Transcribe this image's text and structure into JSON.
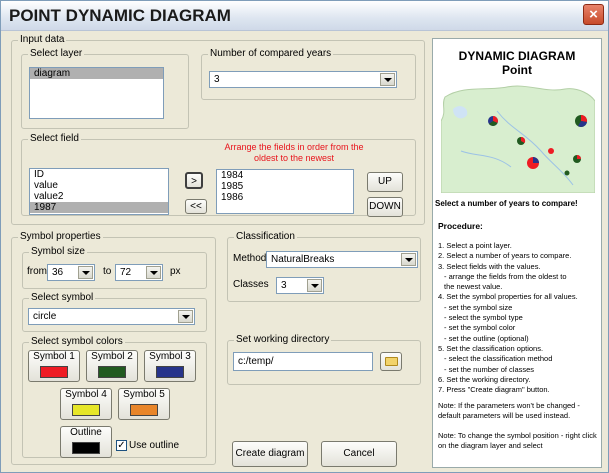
{
  "window": {
    "title": "POINT DYNAMIC DIAGRAM",
    "close_symbol": "×"
  },
  "input_data": {
    "legend": "Input data",
    "select_layer": {
      "legend": "Select layer",
      "items": [
        "diagram"
      ]
    },
    "compared_years": {
      "legend": "Number of compared years",
      "value": "3"
    },
    "select_field": {
      "legend": "Select field",
      "hint": "Arrange the fields in order from the oldest to the newest",
      "available": [
        "ID",
        "value",
        "value2",
        "1987"
      ],
      "selected": [
        "1984",
        "1985",
        "1986"
      ],
      "add_label": ">",
      "remove_label": "<<",
      "up_label": "UP",
      "down_label": "DOWN"
    }
  },
  "symbol_properties": {
    "legend": "Symbol properties",
    "size": {
      "legend": "Symbol size",
      "from_label": "from",
      "from_value": "36",
      "to_label": "to",
      "to_value": "72",
      "unit": "px"
    },
    "symbol": {
      "legend": "Select symbol",
      "value": "circle"
    },
    "colors": {
      "legend": "Select symbol colors",
      "items": [
        {
          "label": "Symbol 1",
          "color": "#ee1c24"
        },
        {
          "label": "Symbol 2",
          "color": "#215a20"
        },
        {
          "label": "Symbol 3",
          "color": "#27348b"
        },
        {
          "label": "Symbol 4",
          "color": "#e6e628"
        },
        {
          "label": "Symbol 5",
          "color": "#e8852a"
        }
      ],
      "outline": {
        "label": "Outline",
        "color": "#000000"
      },
      "use_outline": {
        "label": "Use outline",
        "checked": true
      }
    }
  },
  "classification": {
    "legend": "Classification",
    "method_label": "Method",
    "method_value": "NaturalBreaks",
    "classes_label": "Classes",
    "classes_value": "3"
  },
  "working_directory": {
    "legend": "Set working directory",
    "value": "c:/temp/"
  },
  "actions": {
    "create": "Create diagram",
    "cancel": "Cancel"
  },
  "help": {
    "title": "DYNAMIC DIAGRAM",
    "subtitle": "Point",
    "caption": "Select a number of years to compare!",
    "procedure_title": "Procedure:",
    "procedure": [
      "1. Select a point layer.",
      "2. Select a number of years to compare.",
      "3. Select fields with the values.",
      "   - arrange the fields from the oldest to",
      "   the newest value.",
      "4. Set the symbol properties for all values.",
      "   - set the symbol size",
      "   - select the symbol type",
      "   - set the symbol color",
      "   - set the outline (optional)",
      "5. Set the classification options.",
      "   - select the classification method",
      "   - set the number of classes",
      "6. Set the working directory.",
      "7. Press \"Create diagram\" button."
    ],
    "note1": "Note: If the parameters won't be changed - default parameters will be used instead.",
    "note2": "Note: To change the symbol position - right click on the diagram layer and select"
  }
}
